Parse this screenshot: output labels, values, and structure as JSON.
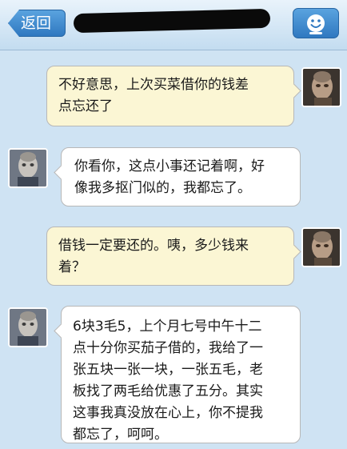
{
  "header": {
    "back_label": "返回",
    "title": "",
    "profile_icon": "smiley-face-icon"
  },
  "messages": [
    {
      "direction": "sent",
      "lines": [
        "不好意思，上次买菜借你的钱差",
        "点忘还了"
      ]
    },
    {
      "direction": "received",
      "lines": [
        "你看你，这点小事还记着啊，好",
        "像我多抠门似的，我都忘了。"
      ]
    },
    {
      "direction": "sent",
      "lines": [
        "借钱一定要还的。咦，多少钱来",
        "着？"
      ]
    },
    {
      "direction": "received",
      "lines": [
        "6块3毛5，上个月七号中午十二",
        "点十分你买茄子借的，我给了一",
        "张五块一张一块，一张五毛，老",
        "板找了两毛给优惠了五分。其实",
        "这事我真没放在心上，你不提我",
        "都忘了，呵呵。"
      ]
    }
  ],
  "colors": {
    "background": "#cfe3f3",
    "sent_bubble": "#fbf6d4",
    "received_bubble": "#ffffff",
    "header_button": "#2f78c0"
  }
}
